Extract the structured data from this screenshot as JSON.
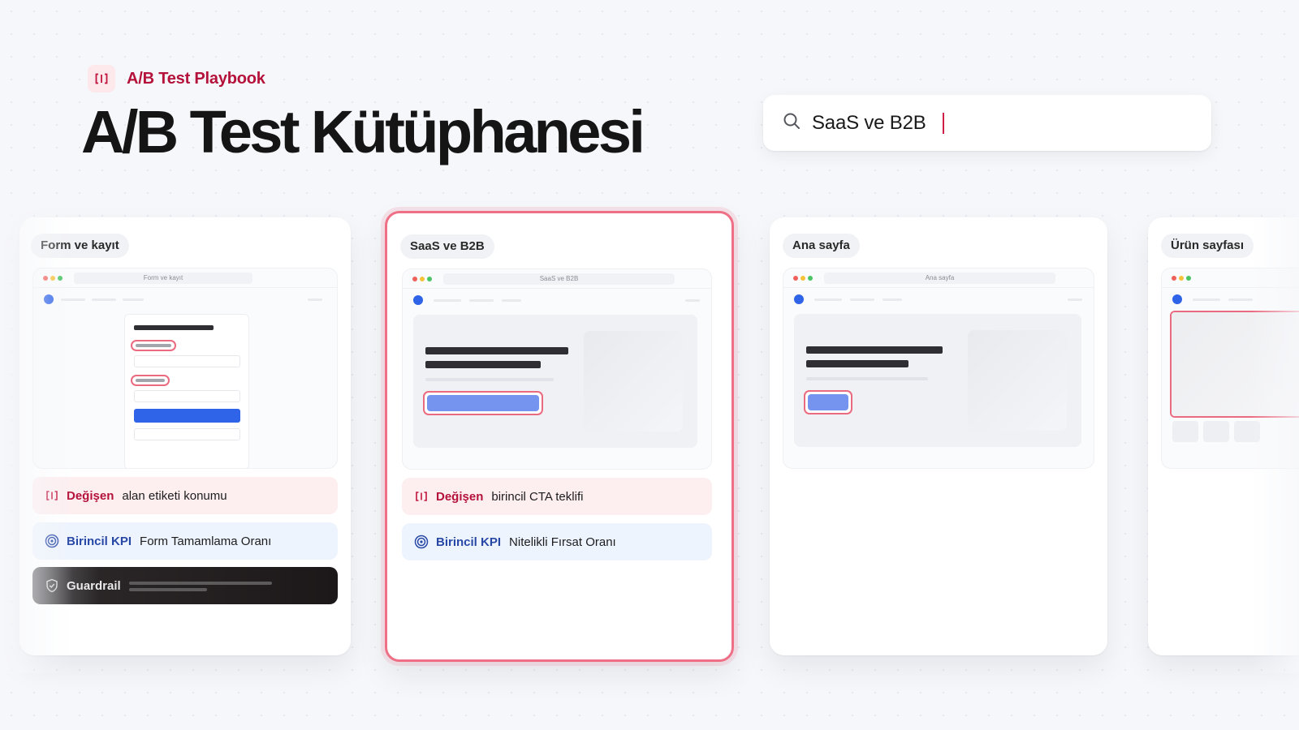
{
  "header": {
    "brand_label": "A/B Test Playbook",
    "title": "A/B Test Kütüphanesi"
  },
  "search": {
    "value": "SaaS ve B2B"
  },
  "cards": [
    {
      "category": "Form ve kayıt",
      "preview_url": "Form ve kayıt",
      "changed_label": "Değişen",
      "changed_value": "alan etiketi konumu",
      "kpi_label": "Birincil KPI",
      "kpi_value": "Form Tamamlama Oranı",
      "guardrail_label": "Guardrail"
    },
    {
      "category": "SaaS ve B2B",
      "preview_url": "SaaS ve B2B",
      "changed_label": "Değişen",
      "changed_value": "birincil CTA teklifi",
      "kpi_label": "Birincil KPI",
      "kpi_value": "Nitelikli Fırsat Oranı",
      "selected": true
    },
    {
      "category": "Ana sayfa",
      "preview_url": "Ana sayfa"
    },
    {
      "category": "Ürün sayfası"
    }
  ],
  "icons": {
    "brand": "bracket-compare-icon",
    "search": "search-icon",
    "changed": "bracket-compare-icon",
    "kpi": "target-icon",
    "guardrail": "shield-check-icon"
  },
  "colors": {
    "accent": "#b4123a",
    "selection_border": "#ee6f86",
    "kpi_text": "#2848a6",
    "cta_blue": "#2f63e8",
    "guardrail_bg": "#1c1819"
  }
}
